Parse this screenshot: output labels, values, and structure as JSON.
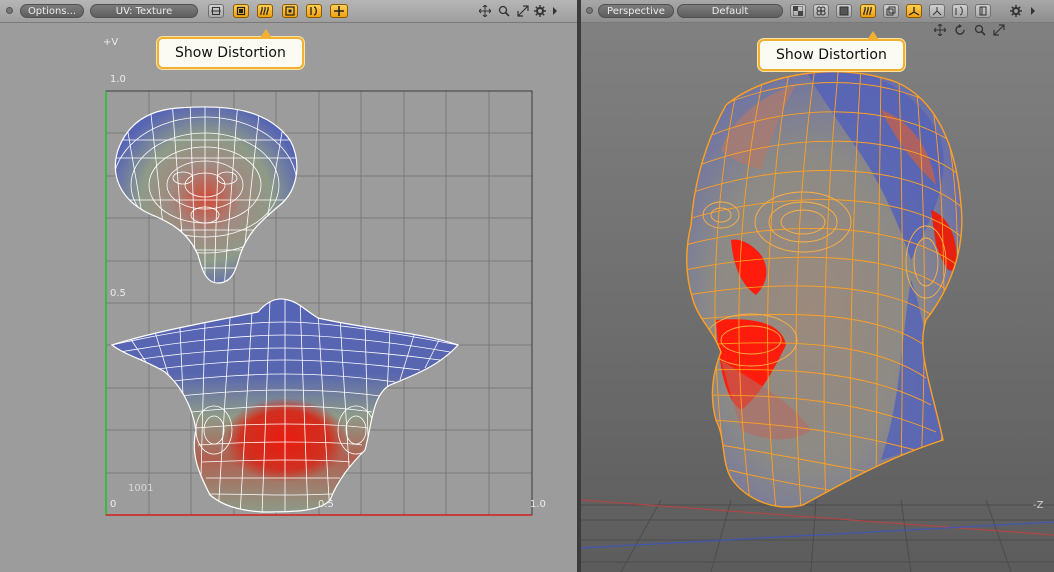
{
  "uv_viewport": {
    "options_label": "Options...",
    "view_label": "UV: Texture",
    "callout": "Show Distortion",
    "axis": {
      "v_label": "+V",
      "top_label": "1.0",
      "mid_label": "0.5",
      "origin_label": "0",
      "x_mid_label": "0.5",
      "x_end_label": "1.0",
      "tile_label": "1001"
    },
    "toolbar_icons": [
      "uv-frame-icon",
      "uv-box-icon",
      "show-distortion-icon",
      "uv-target-icon",
      "uv-pin-icon",
      "uv-cross-icon"
    ],
    "nav_icons": [
      "move-view-icon",
      "zoom-icon",
      "fit-icon",
      "gear-icon",
      "expand-arrow-icon"
    ]
  },
  "perspective_viewport": {
    "view_label": "Perspective",
    "shading_label": "Default",
    "callout": "Show Distortion",
    "axis_label": "-Z",
    "toolbar_icons": [
      "checker-icon",
      "grid-icon",
      "box-icon",
      "show-distortion-icon",
      "camera-icon",
      "axis-icon",
      "sun-icon",
      "open-book-icon",
      "book-icon"
    ],
    "nav_icons": [
      "move-view-icon",
      "rotate-view-icon",
      "zoom-icon",
      "fit-icon",
      "gear-icon",
      "expand-arrow-icon"
    ]
  },
  "colors": {
    "distortion_compressed": "#e02818",
    "distortion_neutral": "#8e9a88",
    "distortion_stretched": "#5664b6",
    "wire_3d": "#ffa020",
    "uv_u_axis": "#d02020",
    "uv_v_axis": "#22c022",
    "accent": "#f2b030"
  }
}
